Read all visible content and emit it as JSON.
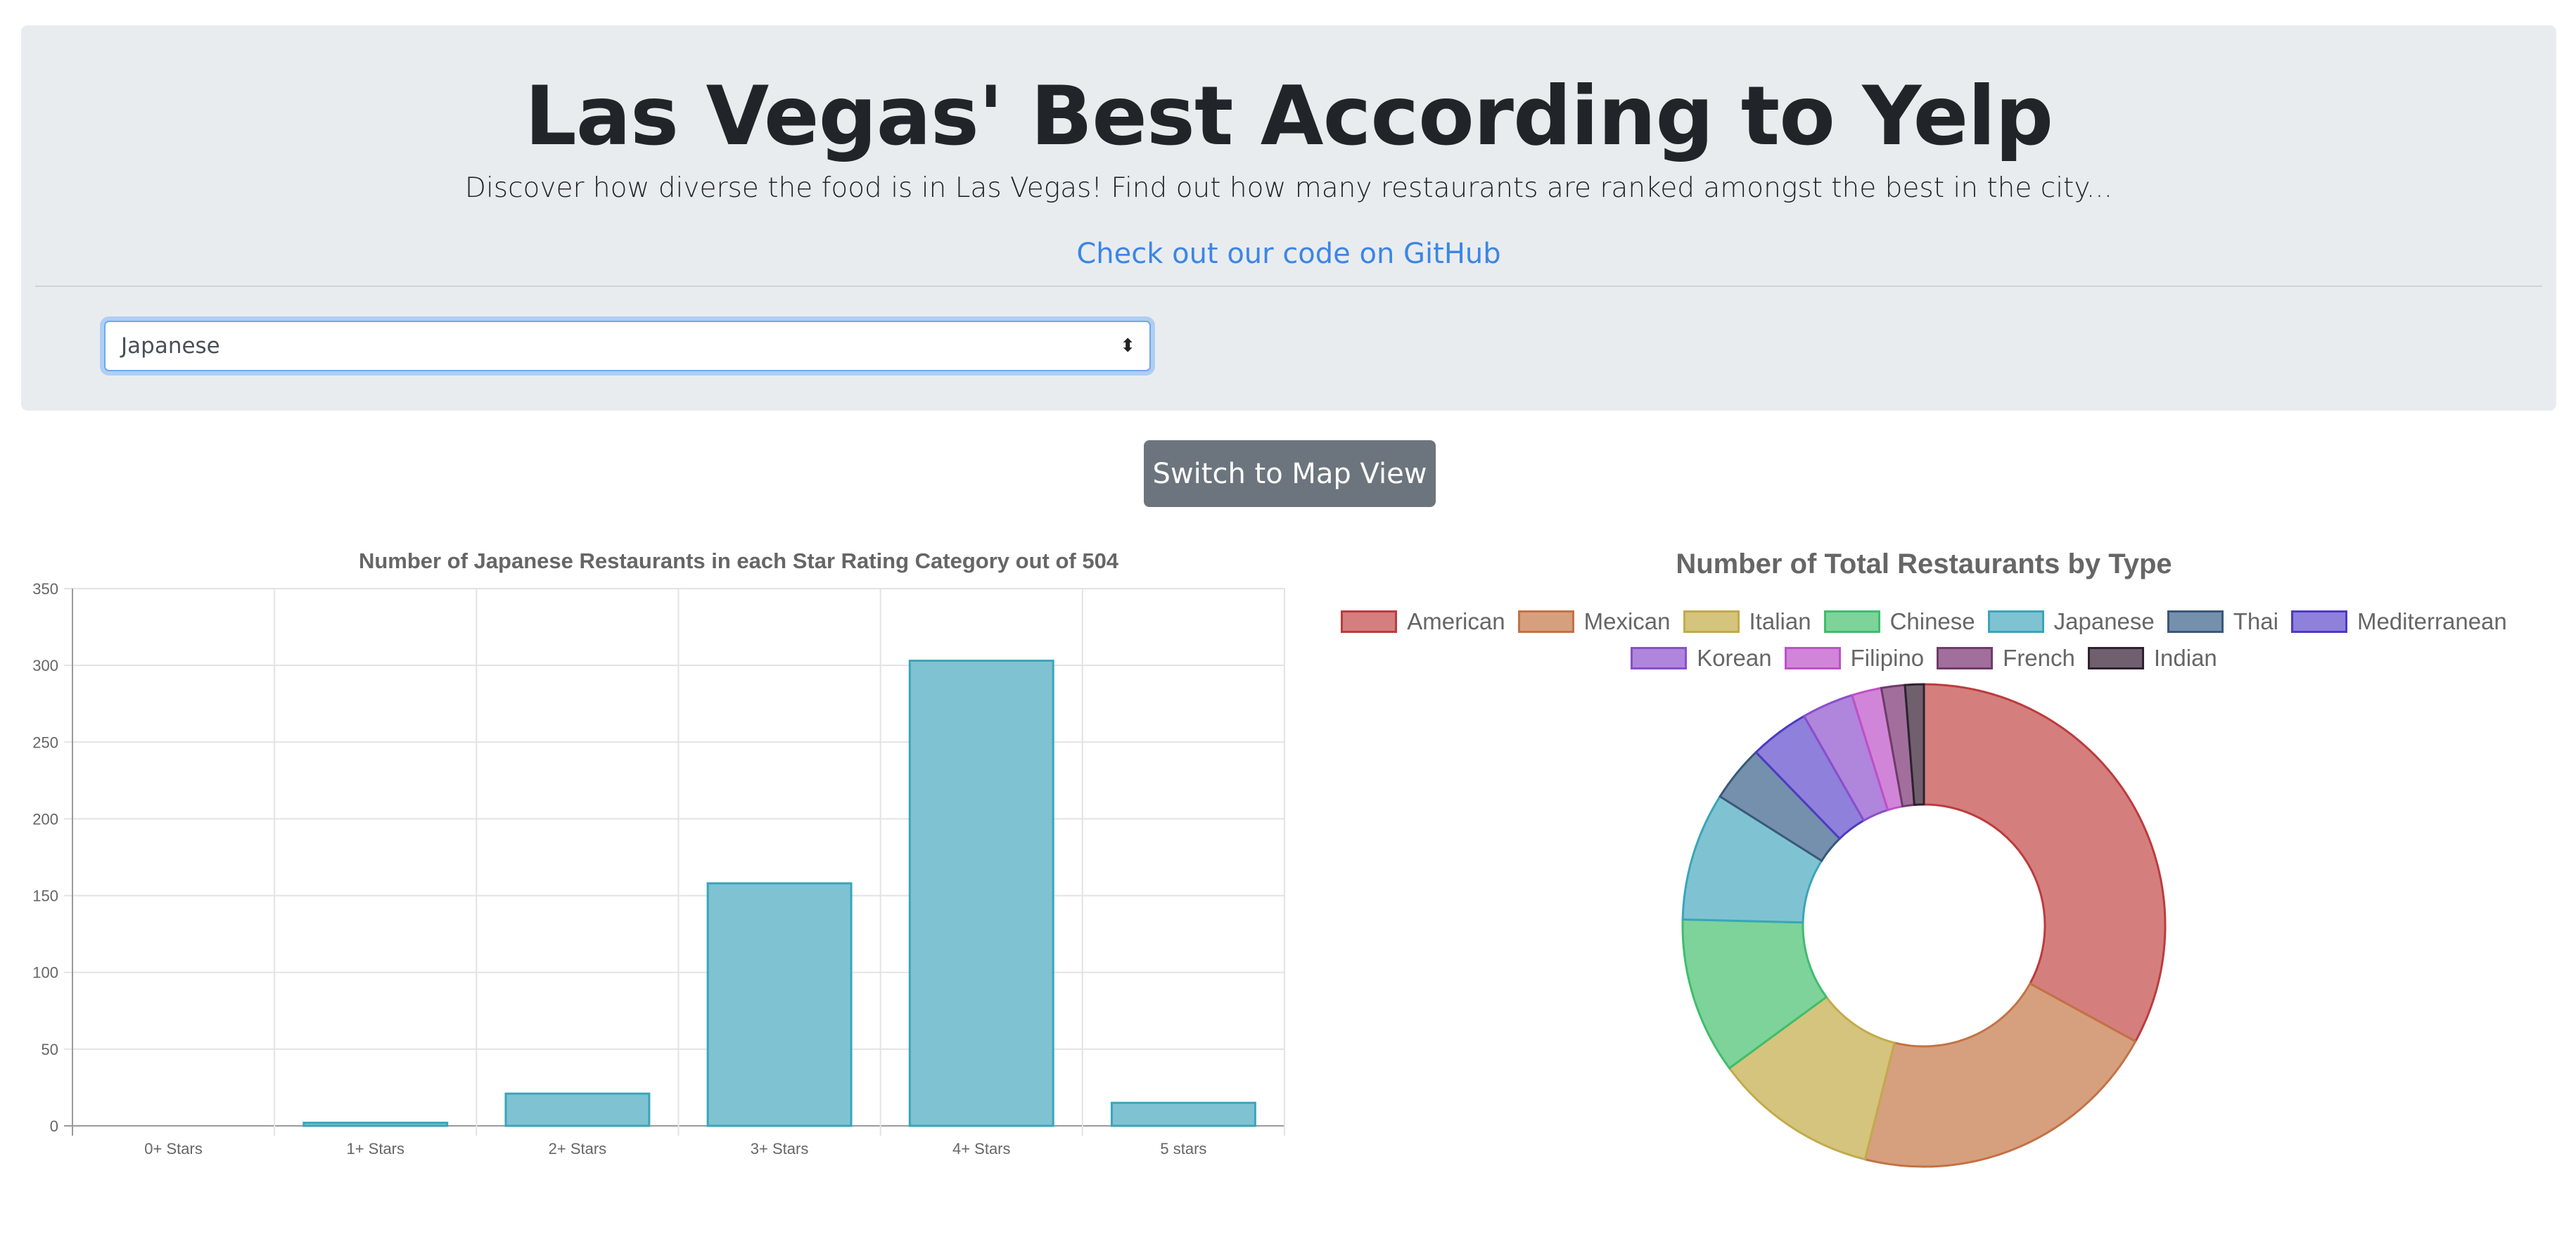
{
  "header": {
    "title": "Las Vegas' Best According to Yelp",
    "lead": "Discover how diverse the food is in Las Vegas! Find out how many restaurants are ranked amongst the best in the city...",
    "github_link": "Check out our code on GitHub"
  },
  "cuisine_select": {
    "selected": "Japanese"
  },
  "map_button": {
    "label": "Switch to Map View"
  },
  "colors": {
    "jumbotron_bg": "#e9ecef",
    "link": "#3b86e6",
    "button_bg": "#6c757d",
    "bar_fill": "#7fc3d3",
    "bar_border": "#3aa5b9"
  },
  "chart_data": [
    {
      "type": "bar",
      "title": "Number of Japanese Restaurants in each Star Rating Category out of 504",
      "categories": [
        "0+ Stars",
        "1+ Stars",
        "2+ Stars",
        "3+ Stars",
        "4+ Stars",
        "5 stars"
      ],
      "values": [
        0,
        2,
        21,
        158,
        303,
        15
      ],
      "ylim": [
        0,
        350
      ],
      "yticks": [
        0,
        50,
        100,
        150,
        200,
        250,
        300,
        350
      ],
      "grid": true,
      "legend": "none"
    },
    {
      "type": "pie",
      "donut": true,
      "title": "Number of Total Restaurants by Type",
      "legend": "top",
      "labels": [
        "American",
        "Mexican",
        "Italian",
        "Chinese",
        "Japanese",
        "Thai",
        "Mediterranean",
        "Korean",
        "Filipino",
        "French",
        "Indian"
      ],
      "values": [
        31.5,
        20.0,
        10.5,
        10.0,
        8.2,
        3.6,
        3.8,
        3.3,
        1.9,
        1.5,
        1.2
      ],
      "colors": [
        "#d47f7e",
        "#d6a07e",
        "#d5c47d",
        "#7dd39a",
        "#7fc3d3",
        "#7490ad",
        "#8f80dc",
        "#b085dc",
        "#d185d8",
        "#a26f9c",
        "#70606e"
      ],
      "border_colors": [
        "#bd3b3d",
        "#c37245",
        "#c2aa4d",
        "#3fbd6b",
        "#3aa5b9",
        "#3a5879",
        "#4d3bc4",
        "#8a4fca",
        "#bf4fc9",
        "#6e3c68",
        "#2e2230"
      ]
    }
  ]
}
